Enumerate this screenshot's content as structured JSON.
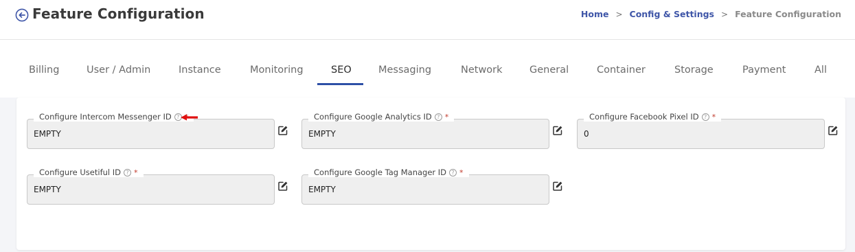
{
  "header": {
    "title": "Feature Configuration",
    "back_icon": "back-arrow-circle-icon"
  },
  "breadcrumb": {
    "items": [
      "Home",
      "Config & Settings",
      "Feature Configuration"
    ],
    "separator": ">"
  },
  "tabs": {
    "items": [
      "Billing",
      "User / Admin",
      "Instance",
      "Monitoring",
      "SEO",
      "Messaging",
      "Network",
      "General",
      "Container",
      "Storage",
      "Payment",
      "All"
    ],
    "active": "SEO"
  },
  "fields": [
    {
      "label": "Configure Intercom Messenger ID",
      "value": "EMPTY",
      "required_mark": "*"
    },
    {
      "label": "Configure Google Analytics ID",
      "value": "EMPTY",
      "required_mark": "*"
    },
    {
      "label": "Configure Facebook Pixel ID",
      "value": "0",
      "required_mark": "*"
    },
    {
      "label": "Configure Usetiful ID",
      "value": "EMPTY",
      "required_mark": "*"
    },
    {
      "label": "Configure Google Tag Manager ID",
      "value": "EMPTY",
      "required_mark": "*"
    }
  ],
  "help_glyph": "?",
  "colors": {
    "accent": "#2d4fa6",
    "breadcrumb_link": "#3f56a8",
    "required": "#c0392b",
    "annotation_arrow": "#e01010"
  }
}
